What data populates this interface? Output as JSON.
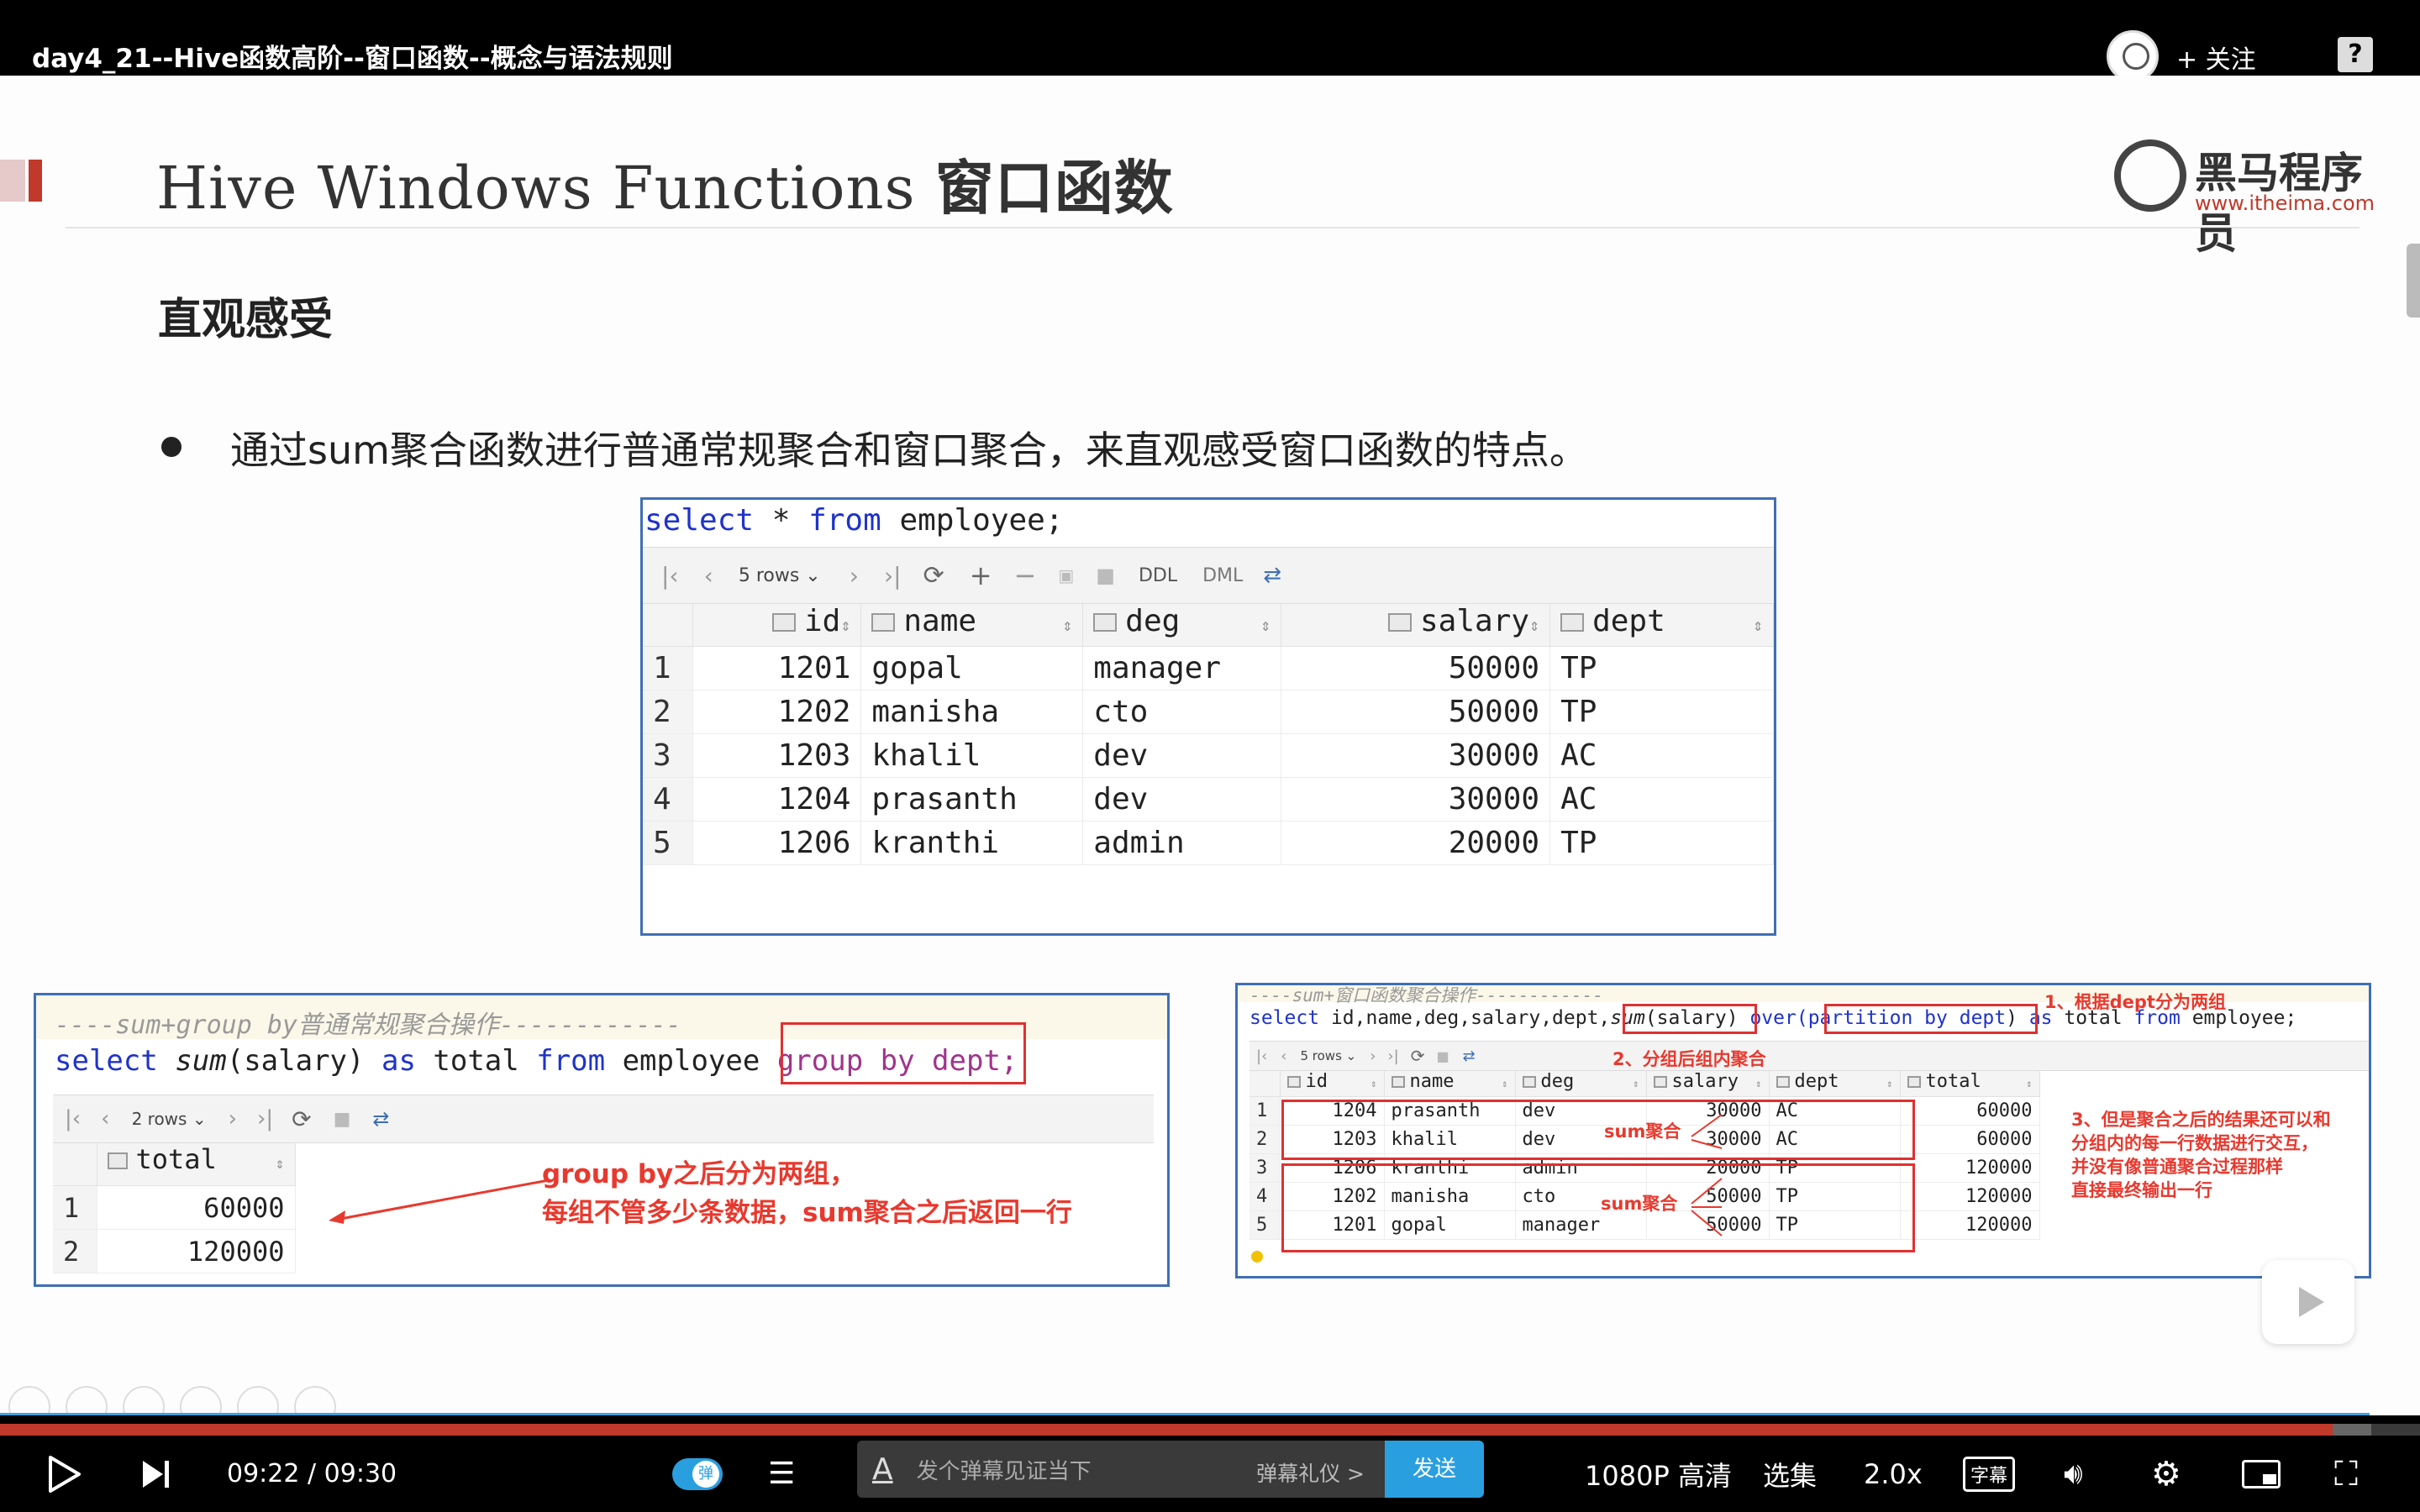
{
  "video": {
    "title": "day4_21--Hive函数高阶--窗口函数--概念与语法规则",
    "follow_label": "+ 关注",
    "help_label": "?"
  },
  "slide": {
    "title_en": "Hive Windows Functions ",
    "title_cn": "窗口函数",
    "logo_text": "黑马程序员",
    "logo_url": "www.itheima.com",
    "section_heading": "直观感受",
    "bullet": "通过sum聚合函数进行普通常规聚合和窗口聚合，来直观感受窗口函数的特点。"
  },
  "panel1": {
    "sql_kw1": "select",
    "sql_mid": " * ",
    "sql_kw2": "from",
    "sql_tail": " employee;",
    "toolbar": {
      "rows": "5 rows ⌄",
      "ddl": "DDL",
      "dml": "DML"
    },
    "columns": [
      "id",
      "name",
      "deg",
      "salary",
      "dept"
    ],
    "rows": [
      [
        "1",
        "1201",
        "gopal",
        "manager",
        "50000",
        "TP"
      ],
      [
        "2",
        "1202",
        "manisha",
        "cto",
        "50000",
        "TP"
      ],
      [
        "3",
        "1203",
        "khalil",
        "dev",
        "30000",
        "AC"
      ],
      [
        "4",
        "1204",
        "prasanth",
        "dev",
        "30000",
        "AC"
      ],
      [
        "5",
        "1206",
        "kranthi",
        "admin",
        "20000",
        "TP"
      ]
    ]
  },
  "panel2": {
    "comment": "----sum+group by普通常规聚合操作------------",
    "sql_kw1": "select",
    "sql_fn": "sum",
    "sql_arg": "(salary) ",
    "sql_kw2": "as",
    "sql_mid": " total ",
    "sql_kw3": "from",
    "sql_mid2": " employee ",
    "sql_hl": "group by dept;",
    "toolbar": {
      "rows": "2 rows ⌄"
    },
    "column": "total",
    "rows": [
      [
        "1",
        "60000"
      ],
      [
        "2",
        "120000"
      ]
    ],
    "annotation_line1": "group by之后分为两组，",
    "annotation_line2": "每组不管多少条数据，sum聚合之后返回一行"
  },
  "panel3": {
    "comment": "----sum+窗口函数聚合操作------------",
    "sql_kw1": "select",
    "sql_cols": " id,name,deg,salary,dept,",
    "sql_fn": "sum",
    "sql_arg": "(salary)",
    "sql_over": " over(",
    "sql_part": "partition by dept",
    "sql_close": ") ",
    "sql_kw2": "as",
    "sql_mid": " total ",
    "sql_kw3": "from",
    "sql_tail": " employee;",
    "toolbar": {
      "rows": "5 rows ⌄"
    },
    "columns": [
      "id",
      "name",
      "deg",
      "salary",
      "dept",
      "total"
    ],
    "rows": [
      [
        "1",
        "1204",
        "prasanth",
        "dev",
        "30000",
        "AC",
        "60000"
      ],
      [
        "2",
        "1203",
        "khalil",
        "dev",
        "30000",
        "AC",
        "60000"
      ],
      [
        "3",
        "1206",
        "kranthi",
        "admin",
        "20000",
        "TP",
        "120000"
      ],
      [
        "4",
        "1202",
        "manisha",
        "cto",
        "50000",
        "TP",
        "120000"
      ],
      [
        "5",
        "1201",
        "gopal",
        "manager",
        "50000",
        "TP",
        "120000"
      ]
    ],
    "note1": "1、根据dept分为两组",
    "note2": "2、分组后组内聚合",
    "note3_l1": "3、但是聚合之后的结果还可以和",
    "note3_l2": "分组内的每一行数据进行交互，",
    "note3_l3": "并没有像普通聚合过程那样",
    "note3_l4": "直接最终输出一行",
    "sum_label_a": "sum聚合",
    "sum_label_b": "sum聚合"
  },
  "player": {
    "current_time": "09:22",
    "separator": "/",
    "duration": "09:30",
    "progress": 0.964,
    "buffered": 0.98,
    "danmaku_glyph": "弹",
    "danmaku_placeholder": "发个弹幕见证当下",
    "gift_label": "弹幕礼仪 >",
    "send_label": "发送",
    "quality": "1080P 高清",
    "episodes": "选集",
    "speed": "2.0x",
    "subtitle": "字幕"
  },
  "colors": {
    "panel_border": "#3f6fb5",
    "keyword": "#1f33c9",
    "annotation_red": "#e8392e",
    "accent_blue": "#2a9fe0",
    "progress_red": "#c0392b"
  }
}
